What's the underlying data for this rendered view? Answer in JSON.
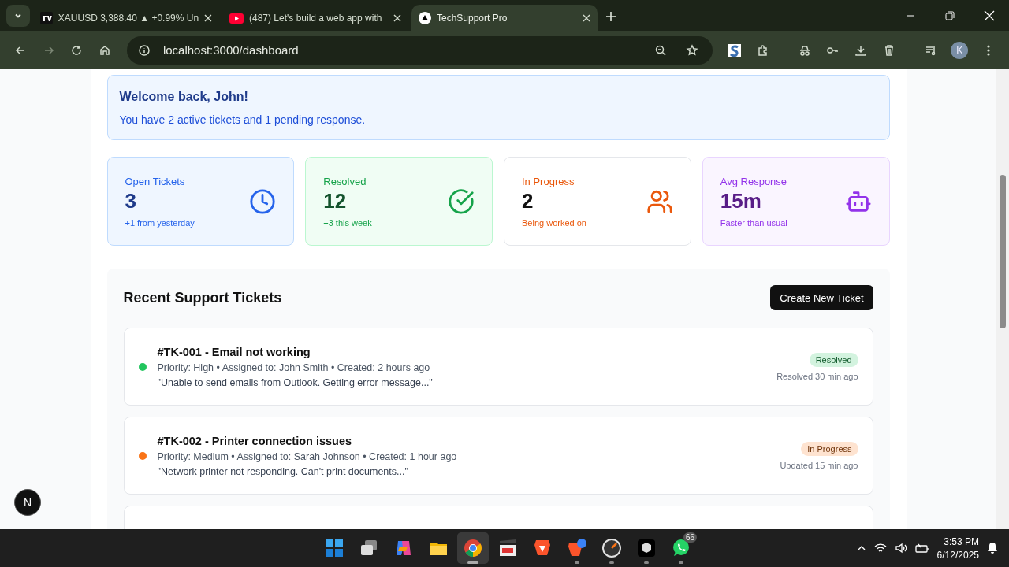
{
  "browser": {
    "tabs": [
      {
        "kind": "chart",
        "title": "XAUUSD 3,388.40 ▲ +0.99% Un",
        "selected": false
      },
      {
        "kind": "video",
        "title": "(487) Let's build a web app with",
        "selected": false
      },
      {
        "kind": "app",
        "title": "TechSupport Pro",
        "selected": true
      }
    ],
    "address": "localhost:3000/dashboard",
    "profile": "K"
  },
  "welcome": {
    "title": "Welcome back, John!",
    "message": "You have 2 active tickets and 1 pending response."
  },
  "stats": [
    {
      "kind": "open",
      "label": "Open Tickets",
      "value": "3",
      "note": "+1 from yesterday"
    },
    {
      "kind": "resolved",
      "label": "Resolved",
      "value": "12",
      "note": "+3 this week"
    },
    {
      "kind": "progress",
      "label": "In Progress",
      "value": "2",
      "note": "Being worked on"
    },
    {
      "kind": "response",
      "label": "Avg Response",
      "value": "15m",
      "note": "Faster than usual"
    }
  ],
  "tickets": {
    "title": "Recent Support Tickets",
    "create_button": "Create New Ticket",
    "items": [
      {
        "color": "#22c55e",
        "title": "#TK-001 - Email not working",
        "meta": "Priority: High • Assigned to: John Smith • Created: 2 hours ago",
        "quote": "\"Unable to send emails from Outlook. Getting error message...\"",
        "status": "Resolved",
        "time": "Resolved 30 min ago"
      },
      {
        "color": "#f97316",
        "title": "#TK-002 - Printer connection issues",
        "meta": "Priority: Medium • Assigned to: Sarah Johnson • Created: 1 hour ago",
        "quote": "\"Network printer not responding. Can't print documents...\"",
        "status": "In Progress",
        "time": "Updated 15 min ago"
      }
    ]
  },
  "dev_badge": "N",
  "taskbar": {
    "apps": [
      {
        "kind": "start",
        "selected": false,
        "running": false
      },
      {
        "kind": "taskview",
        "selected": false,
        "running": false
      },
      {
        "kind": "copilot",
        "selected": false,
        "running": false
      },
      {
        "kind": "folder",
        "selected": false,
        "running": false
      },
      {
        "kind": "chrome",
        "selected": true,
        "running": true
      },
      {
        "kind": "clapper",
        "selected": false,
        "running": false
      },
      {
        "kind": "lion",
        "selected": false,
        "running": false
      },
      {
        "kind": "lion2",
        "selected": false,
        "running": true
      },
      {
        "kind": "gauge",
        "selected": false,
        "running": true
      },
      {
        "kind": "cube",
        "selected": false,
        "running": true
      },
      {
        "kind": "chat",
        "selected": false,
        "running": true,
        "badge": "66"
      }
    ],
    "time": "3:53 PM",
    "date": "6/12/2025"
  }
}
